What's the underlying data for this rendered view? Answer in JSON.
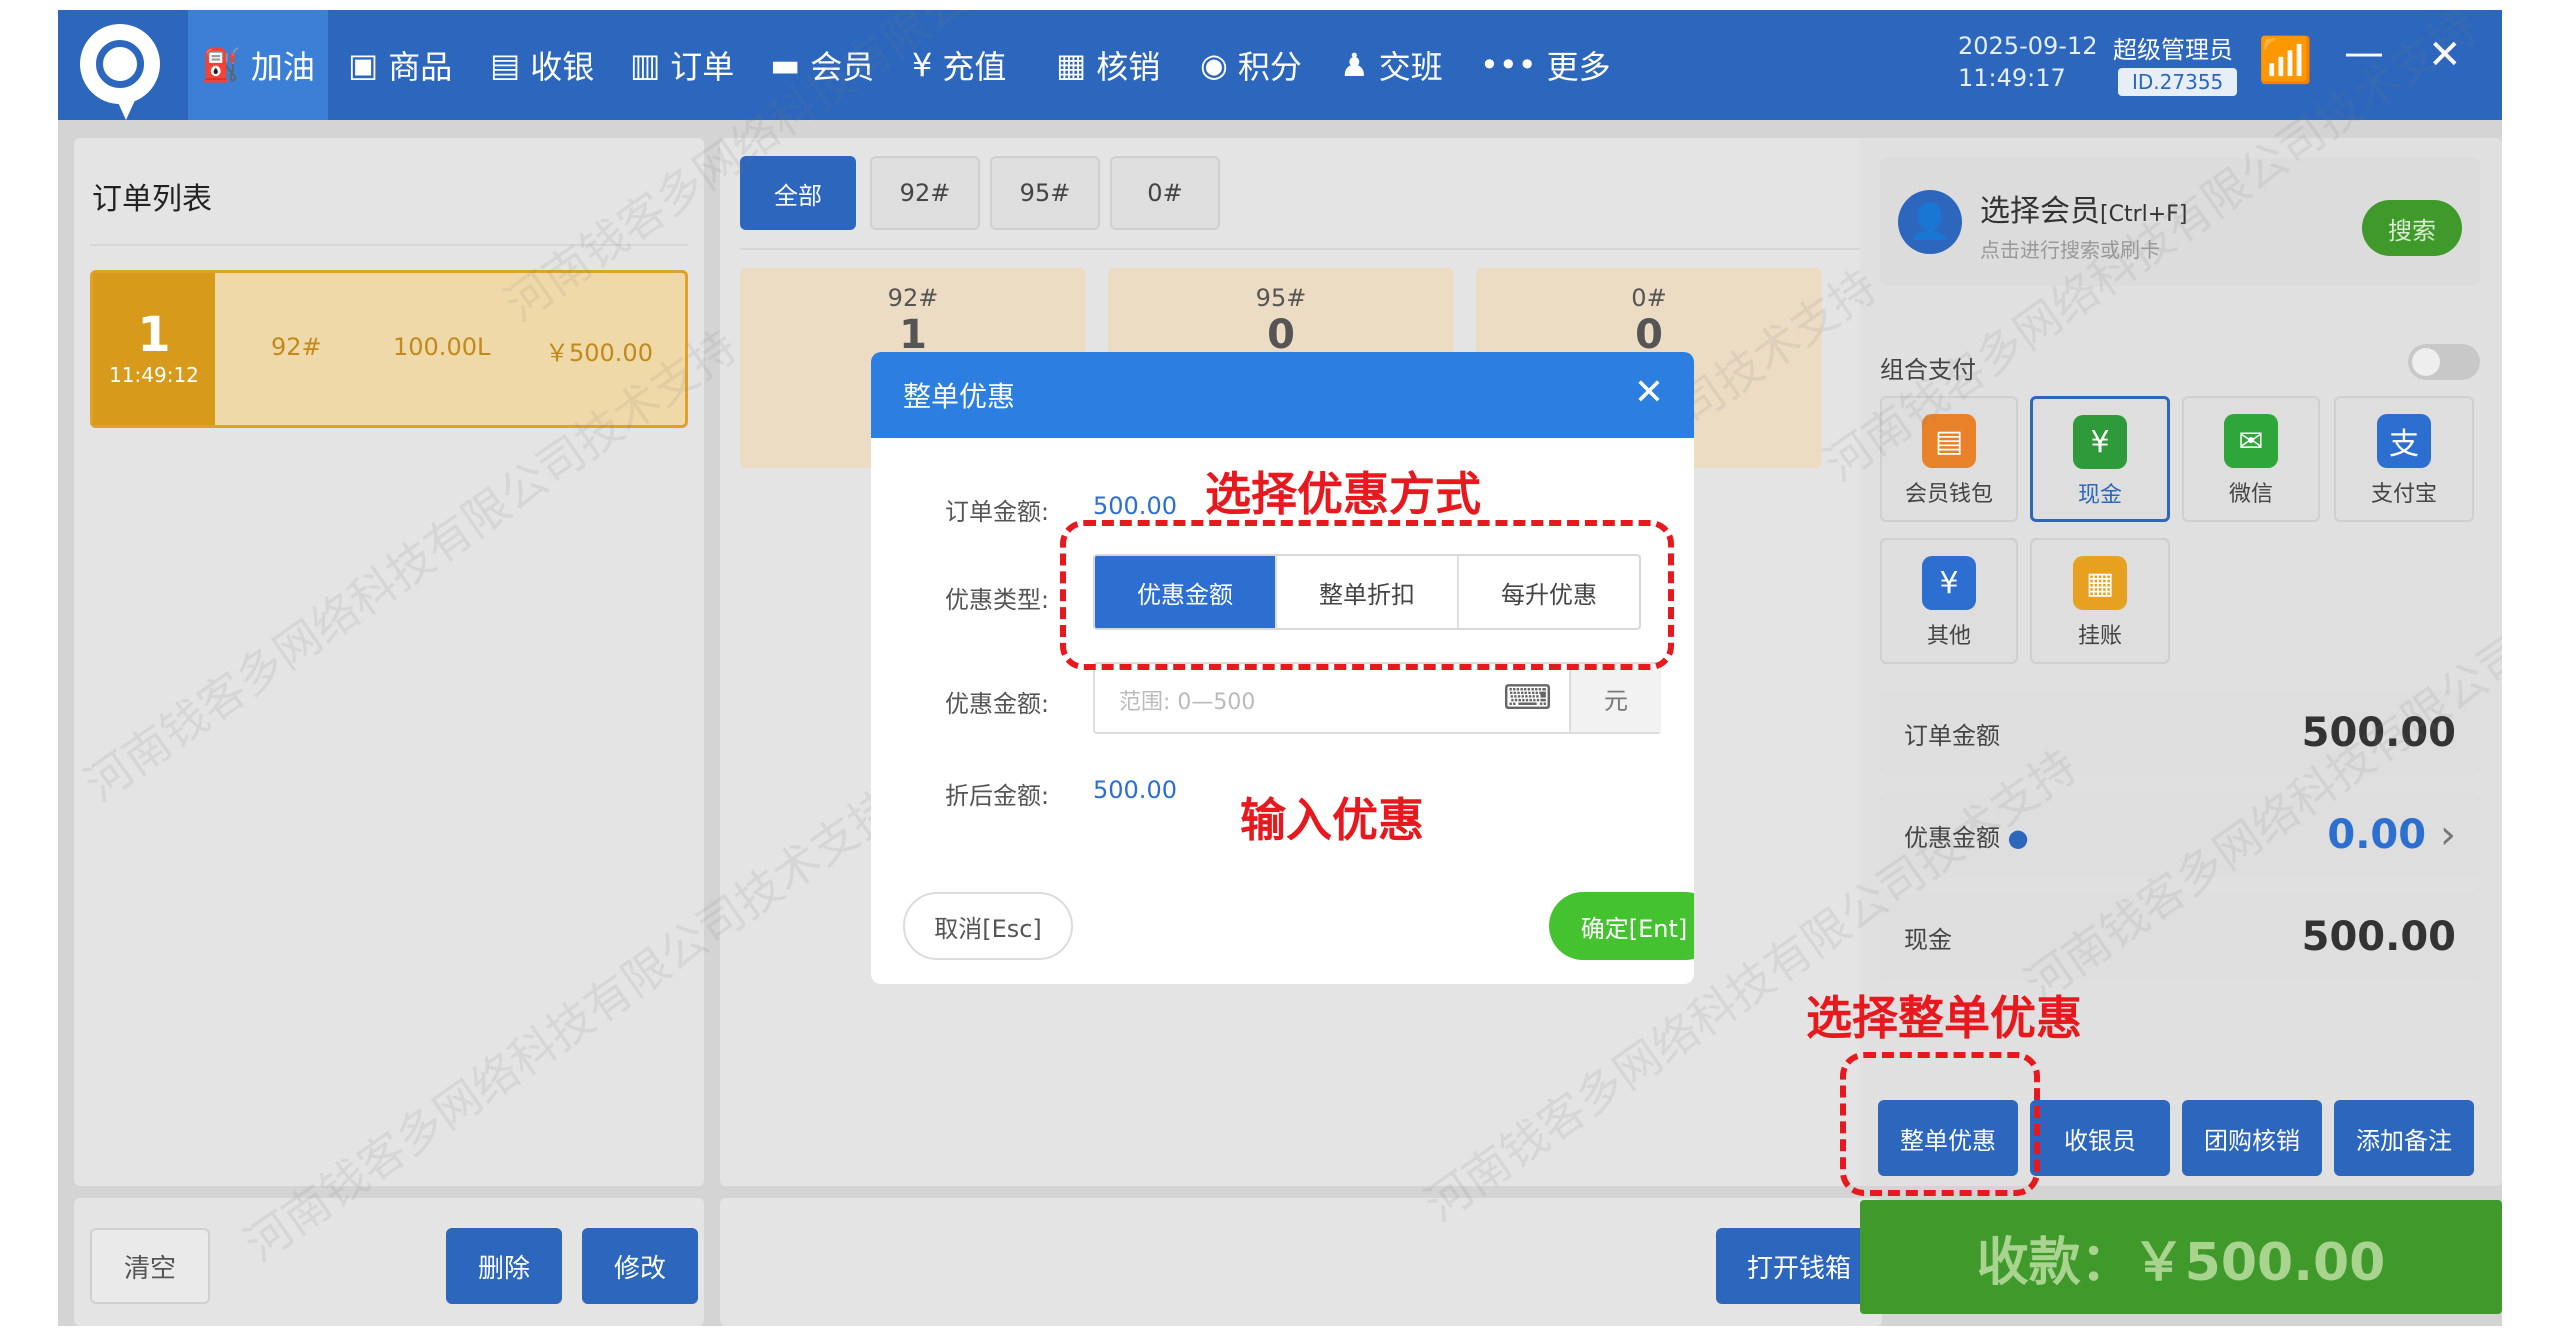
{
  "nav": {
    "items": [
      {
        "label": "加油",
        "icon": "fuel-pump-icon"
      },
      {
        "label": "商品",
        "icon": "bag-icon"
      },
      {
        "label": "收银",
        "icon": "cashier-icon"
      },
      {
        "label": "订单",
        "icon": "order-icon"
      },
      {
        "label": "会员",
        "icon": "member-card-icon"
      },
      {
        "label": "充值",
        "icon": "recharge-icon"
      },
      {
        "label": "核销",
        "icon": "ticket-icon"
      },
      {
        "label": "积分",
        "icon": "coins-icon"
      },
      {
        "label": "交班",
        "icon": "shift-icon"
      },
      {
        "label": "更多",
        "icon": "more-dots-icon"
      }
    ],
    "date": "2025-09-12",
    "time": "11:49:17",
    "admin": "超级管理员",
    "id": "ID.27355"
  },
  "orders": {
    "title": "订单列表",
    "list": [
      {
        "num": "1",
        "time": "11:49:12",
        "fuel": "92#",
        "volume": "100.00L",
        "amount": "￥500.00"
      }
    ],
    "clear": "清空",
    "delete": "删除",
    "modify": "修改"
  },
  "fuel": {
    "tabs": [
      "全部",
      "92#",
      "95#",
      "0#"
    ],
    "cards": [
      {
        "label": "92#",
        "count": "1"
      },
      {
        "label": "95#",
        "count": "0"
      },
      {
        "label": "0#",
        "count": "0"
      }
    ],
    "open_drawer": "打开钱箱"
  },
  "member": {
    "title": "选择会员",
    "shortcut": "[Ctrl+F]",
    "hint": "点击进行搜索或刷卡",
    "search": "搜索"
  },
  "payment": {
    "combo_label": "组合支付",
    "methods": [
      {
        "label": "会员钱包",
        "color": "#e8822a"
      },
      {
        "label": "现金",
        "color": "#2e9a3a"
      },
      {
        "label": "微信",
        "color": "#2ea63a"
      },
      {
        "label": "支付宝",
        "color": "#2c6fd0"
      },
      {
        "label": "其他",
        "color": "#2c6fd0"
      },
      {
        "label": "挂账",
        "color": "#e8a020"
      }
    ],
    "order_amount_label": "订单金额",
    "order_amount": "500.00",
    "discount_label": "优惠金额",
    "discount": "0.00",
    "cash_label": "现金",
    "cash": "500.00",
    "buttons": [
      "整单优惠",
      "收银员",
      "团购核销",
      "添加备注"
    ],
    "collect_label": "收款：",
    "collect_amount": "￥500.00"
  },
  "modal": {
    "title": "整单优惠",
    "order_amount_label": "订单金额:",
    "order_amount": "500.00",
    "type_label": "优惠类型:",
    "types": [
      "优惠金额",
      "整单折扣",
      "每升优惠"
    ],
    "amount_label": "优惠金额:",
    "placeholder": "范围: 0—500",
    "unit": "元",
    "after_label": "折后金额:",
    "after_amount": "500.00",
    "cancel": "取消[Esc]",
    "confirm": "确定[Ent]"
  },
  "annotations": {
    "choose_type": "选择优惠方式",
    "enter_discount": "输入优惠",
    "choose_whole": "选择整单优惠"
  },
  "watermark": "河南钱客多网络科技有限公司技术支持"
}
